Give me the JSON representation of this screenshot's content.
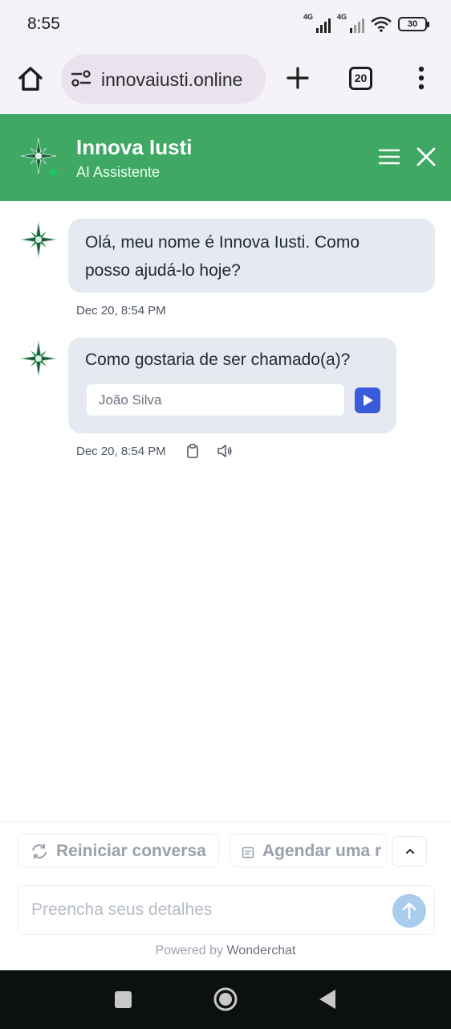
{
  "status_bar": {
    "time": "8:55",
    "signal_1": "4G",
    "signal_2": "4G",
    "battery": "30"
  },
  "browser": {
    "url": "innovaiusti.online",
    "tab_count": "20",
    "icons": [
      "home-icon",
      "site-settings-icon",
      "new-tab-icon",
      "tab-switcher",
      "more-menu-icon"
    ]
  },
  "chat_header": {
    "title": "Innova Iusti",
    "subtitle": "AI Assistente",
    "accent_color": "#3fa864",
    "icons": [
      "compass-logo",
      "menu-icon",
      "close-icon"
    ]
  },
  "messages": [
    {
      "text_line1": "Olá, meu nome é Innova Iusti. Como",
      "text_line2": "posso ajudá-lo hoje?",
      "timestamp": "Dec 20, 8:54 PM"
    },
    {
      "text": "Como gostaria de ser chamado(a)?",
      "input_placeholder": "João Silva",
      "timestamp": "Dec 20, 8:54 PM",
      "icons": [
        "copy-icon",
        "speaker-icon"
      ]
    }
  ],
  "actions": {
    "restart_label": "Reiniciar conversa",
    "schedule_label": "Agendar uma r"
  },
  "composer": {
    "placeholder": "Preencha seus detalhes"
  },
  "footer": {
    "powered_prefix": "Powered by",
    "powered_brand": "Wonderchat"
  },
  "nav": {
    "icons": [
      "recents-icon",
      "home-icon",
      "back-icon"
    ]
  }
}
